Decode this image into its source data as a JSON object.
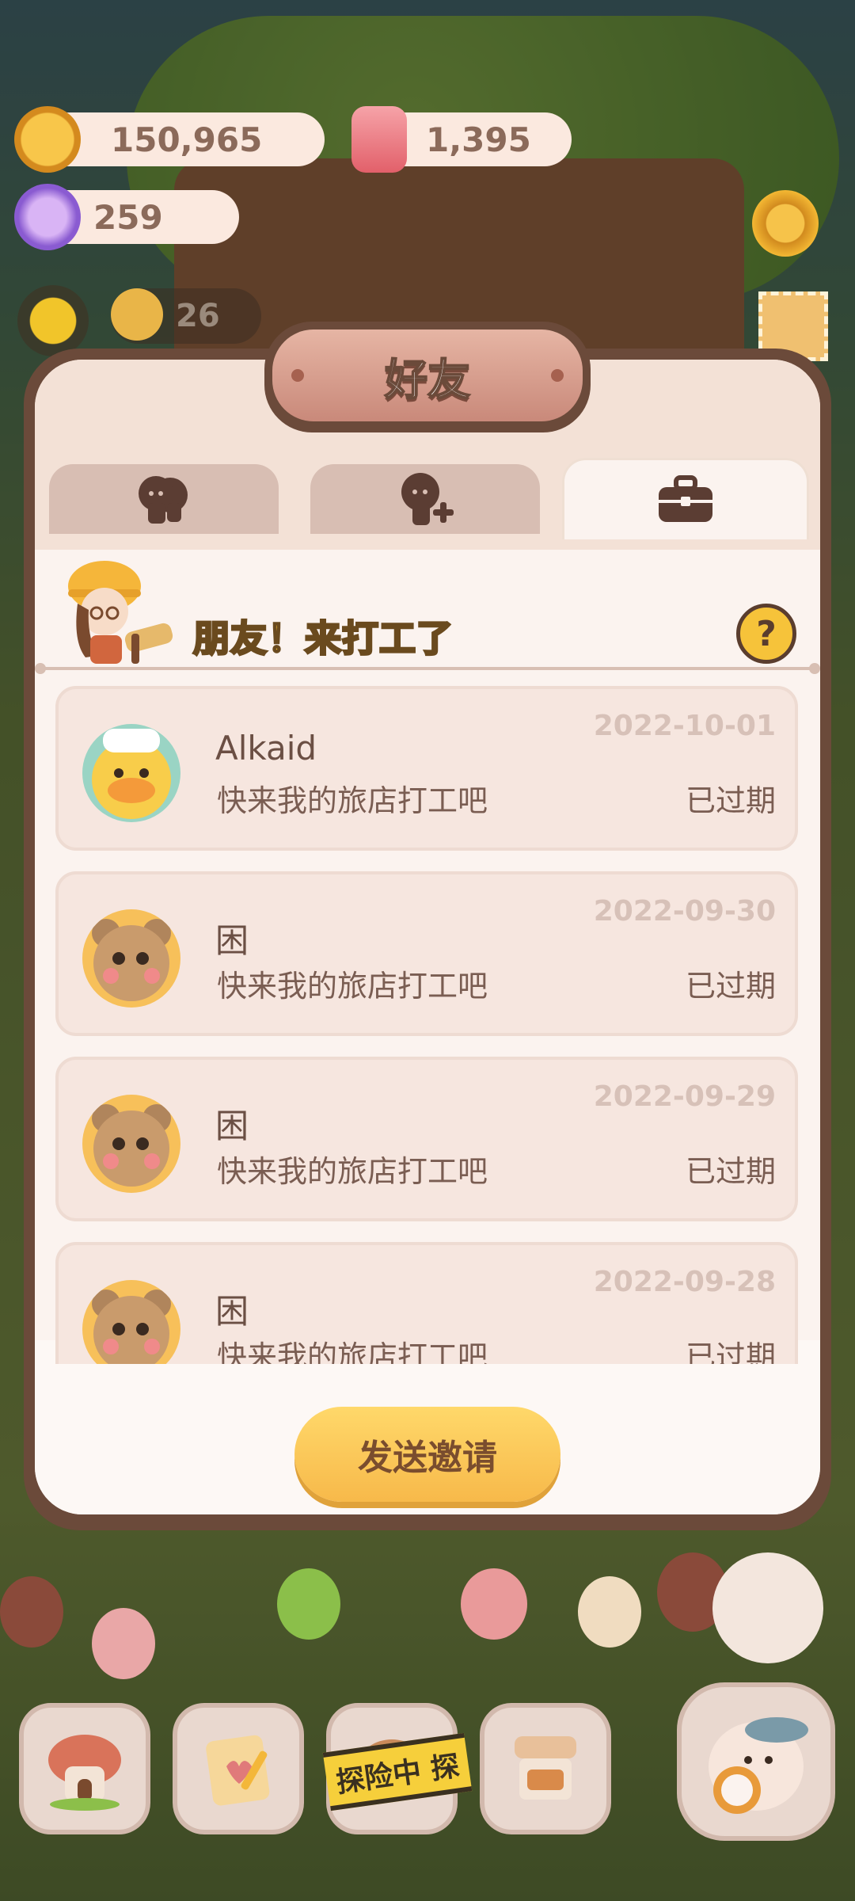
{
  "hud": {
    "coins": "150,965",
    "candy": "1,395",
    "gems": "259",
    "level": "26"
  },
  "dialog": {
    "title": "好友",
    "tabs": [
      {
        "name": "friends",
        "icon": "friends-icon",
        "active": false
      },
      {
        "name": "add-friend",
        "icon": "add-friend-icon",
        "active": false
      },
      {
        "name": "work",
        "icon": "briefcase-icon",
        "active": true
      }
    ],
    "banner_title": "朋友！来打工了",
    "help_label": "?",
    "invites": [
      {
        "name": "Alkaid",
        "message": "快来我的旅店打工吧",
        "date": "2022-10-01",
        "status": "已过期",
        "avatar": "duck-avatar"
      },
      {
        "name": "困",
        "message": "快来我的旅店打工吧",
        "date": "2022-09-30",
        "status": "已过期",
        "avatar": "bear-avatar"
      },
      {
        "name": "困",
        "message": "快来我的旅店打工吧",
        "date": "2022-09-29",
        "status": "已过期",
        "avatar": "bear-avatar"
      },
      {
        "name": "困",
        "message": "快来我的旅店打工吧",
        "date": "2022-09-28",
        "status": "已过期",
        "avatar": "bear-avatar"
      }
    ],
    "send_button": "发送邀请"
  },
  "bottom_nav": {
    "explore_tape": "探险中 探"
  },
  "colors": {
    "panel": "#fbf3ef",
    "frame": "#6b4a3a",
    "accent_yellow": "#f7b94a",
    "card": "#f6e6df"
  }
}
